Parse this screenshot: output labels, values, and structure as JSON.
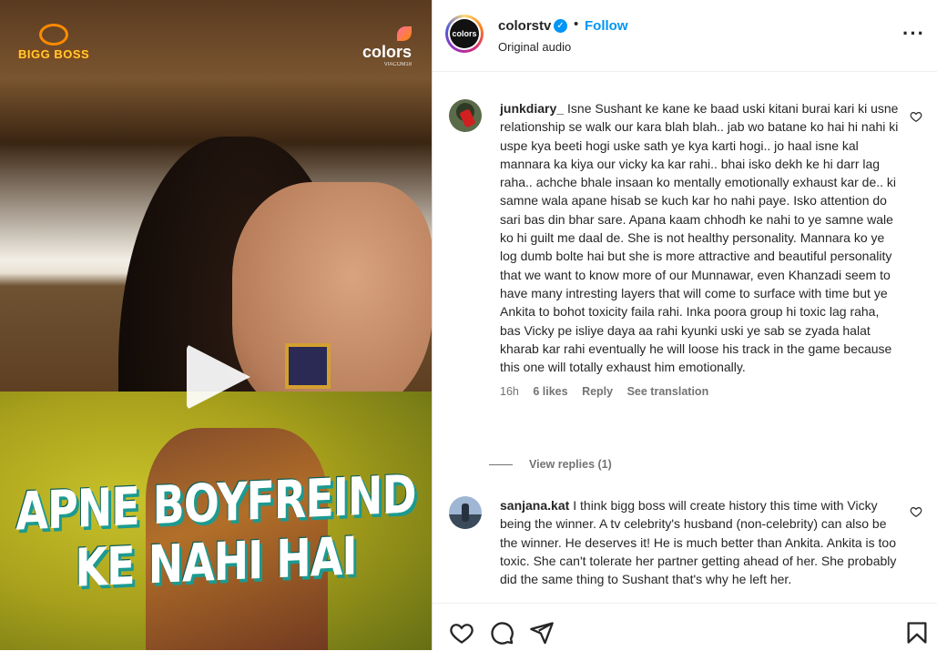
{
  "media": {
    "brand_logo": "BIGG BOSS",
    "channel_logo": "colors",
    "channel_sub": "VIACOM18",
    "caption_line1": "APNE BOYFREIND",
    "caption_line2": "KE NAHI HAI",
    "play_icon": "play-icon"
  },
  "header": {
    "avatar_text": "colors",
    "username": "colorstv",
    "verified_icon": "verified-badge-icon",
    "separator": "•",
    "follow_label": "Follow",
    "subtitle": "Original audio",
    "more_icon": "more-options-icon"
  },
  "comments": [
    {
      "username": "junkdiary_",
      "text": "Isne Sushant ke kane ke baad uski kitani burai kari ki usne relationship se walk our kara blah blah.. jab wo batane ko hai hi nahi ki uspe kya beeti hogi uske sath ye kya karti hogi.. jo haal isne kal mannara ka kiya our vicky ka kar rahi.. bhai isko dekh ke hi darr lag raha.. achche bhale insaan ko mentally emotionally exhaust kar de.. ki samne wala apane hisab se kuch kar ho nahi paye. Isko attention do sari bas din bhar sare. Apana kaam chhodh ke nahi to ye samne wale ko hi guilt me daal de. She is not healthy personality. Mannara ko ye log dumb bolte hai but she is more attractive and beautiful personality that we want to know more of our Munnawar, even Khanzadi seem to have many intresting layers that will come to surface with time but ye Ankita to bohot toxicity faila rahi. Inka poora group hi toxic lag raha, bas Vicky pe isliye daya aa rahi kyunki uski ye sab se zyada halat kharab kar rahi eventually he will loose his track in the game because this one will totally exhaust him emotionally.",
      "time": "16h",
      "likes": "6 likes",
      "reply": "Reply",
      "translate": "See translation",
      "view_replies": "View replies (1)"
    },
    {
      "username": "sanjana.kat",
      "text": "I think bigg boss will create history this time with Vicky being the winner. A tv celebrity's husband (non-celebrity) can also be the winner. He deserves it! He is much better than Ankita. Ankita is too toxic. She can't tolerate her partner getting ahead of her. She probably did the same thing to Sushant that's why he left her."
    }
  ],
  "actions": {
    "like_icon": "heart-icon",
    "comment_icon": "comment-icon",
    "share_icon": "share-icon",
    "save_icon": "bookmark-icon"
  },
  "colors": {
    "accent": "#0095f6",
    "text": "#262626",
    "muted": "#737373",
    "caption_shadow": "#1d9a8f"
  }
}
